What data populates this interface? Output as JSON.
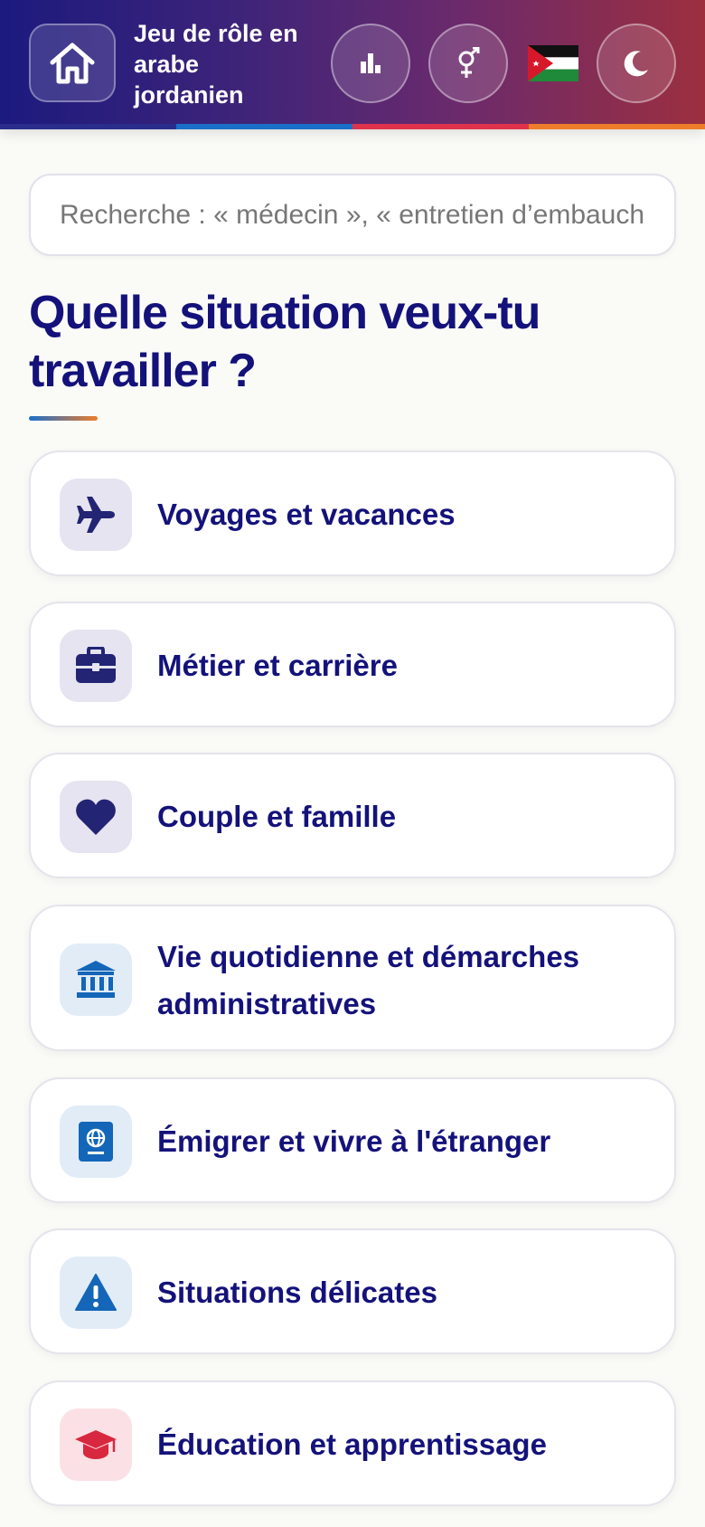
{
  "header": {
    "title": "Jeu de rôle en arabe jordanien",
    "home_icon": "home-icon",
    "stats_icon": "bar-chart-icon",
    "gender_icon": "gender-icon",
    "flag_icon": "jordan-flag-icon",
    "theme_icon": "moon-icon"
  },
  "search": {
    "placeholder": "Recherche : « médecin », « entretien d’embauche »"
  },
  "main": {
    "heading": "Quelle situation veux-tu travailler ?"
  },
  "categories": [
    {
      "label": "Voyages et vacances",
      "icon": "airplane-icon",
      "icon_color": "#232474",
      "bg_color": "#e5e4f0"
    },
    {
      "label": "Métier et carrière",
      "icon": "briefcase-icon",
      "icon_color": "#232474",
      "bg_color": "#e5e4f0"
    },
    {
      "label": "Couple et famille",
      "icon": "heart-icon",
      "icon_color": "#232474",
      "bg_color": "#e5e4f0"
    },
    {
      "label": "Vie quotidienne et démarches administratives",
      "icon": "bank-icon",
      "icon_color": "#1466b8",
      "bg_color": "#e1ecf7"
    },
    {
      "label": "Émigrer et vivre à l'étranger",
      "icon": "passport-icon",
      "icon_color": "#1466b8",
      "bg_color": "#e1ecf7"
    },
    {
      "label": "Situations délicates",
      "icon": "warning-icon",
      "icon_color": "#1466b8",
      "bg_color": "#e1ecf7"
    },
    {
      "label": "Éducation et apprentissage",
      "icon": "graduation-cap-icon",
      "icon_color": "#d8283f",
      "bg_color": "#fbe1e5"
    }
  ]
}
